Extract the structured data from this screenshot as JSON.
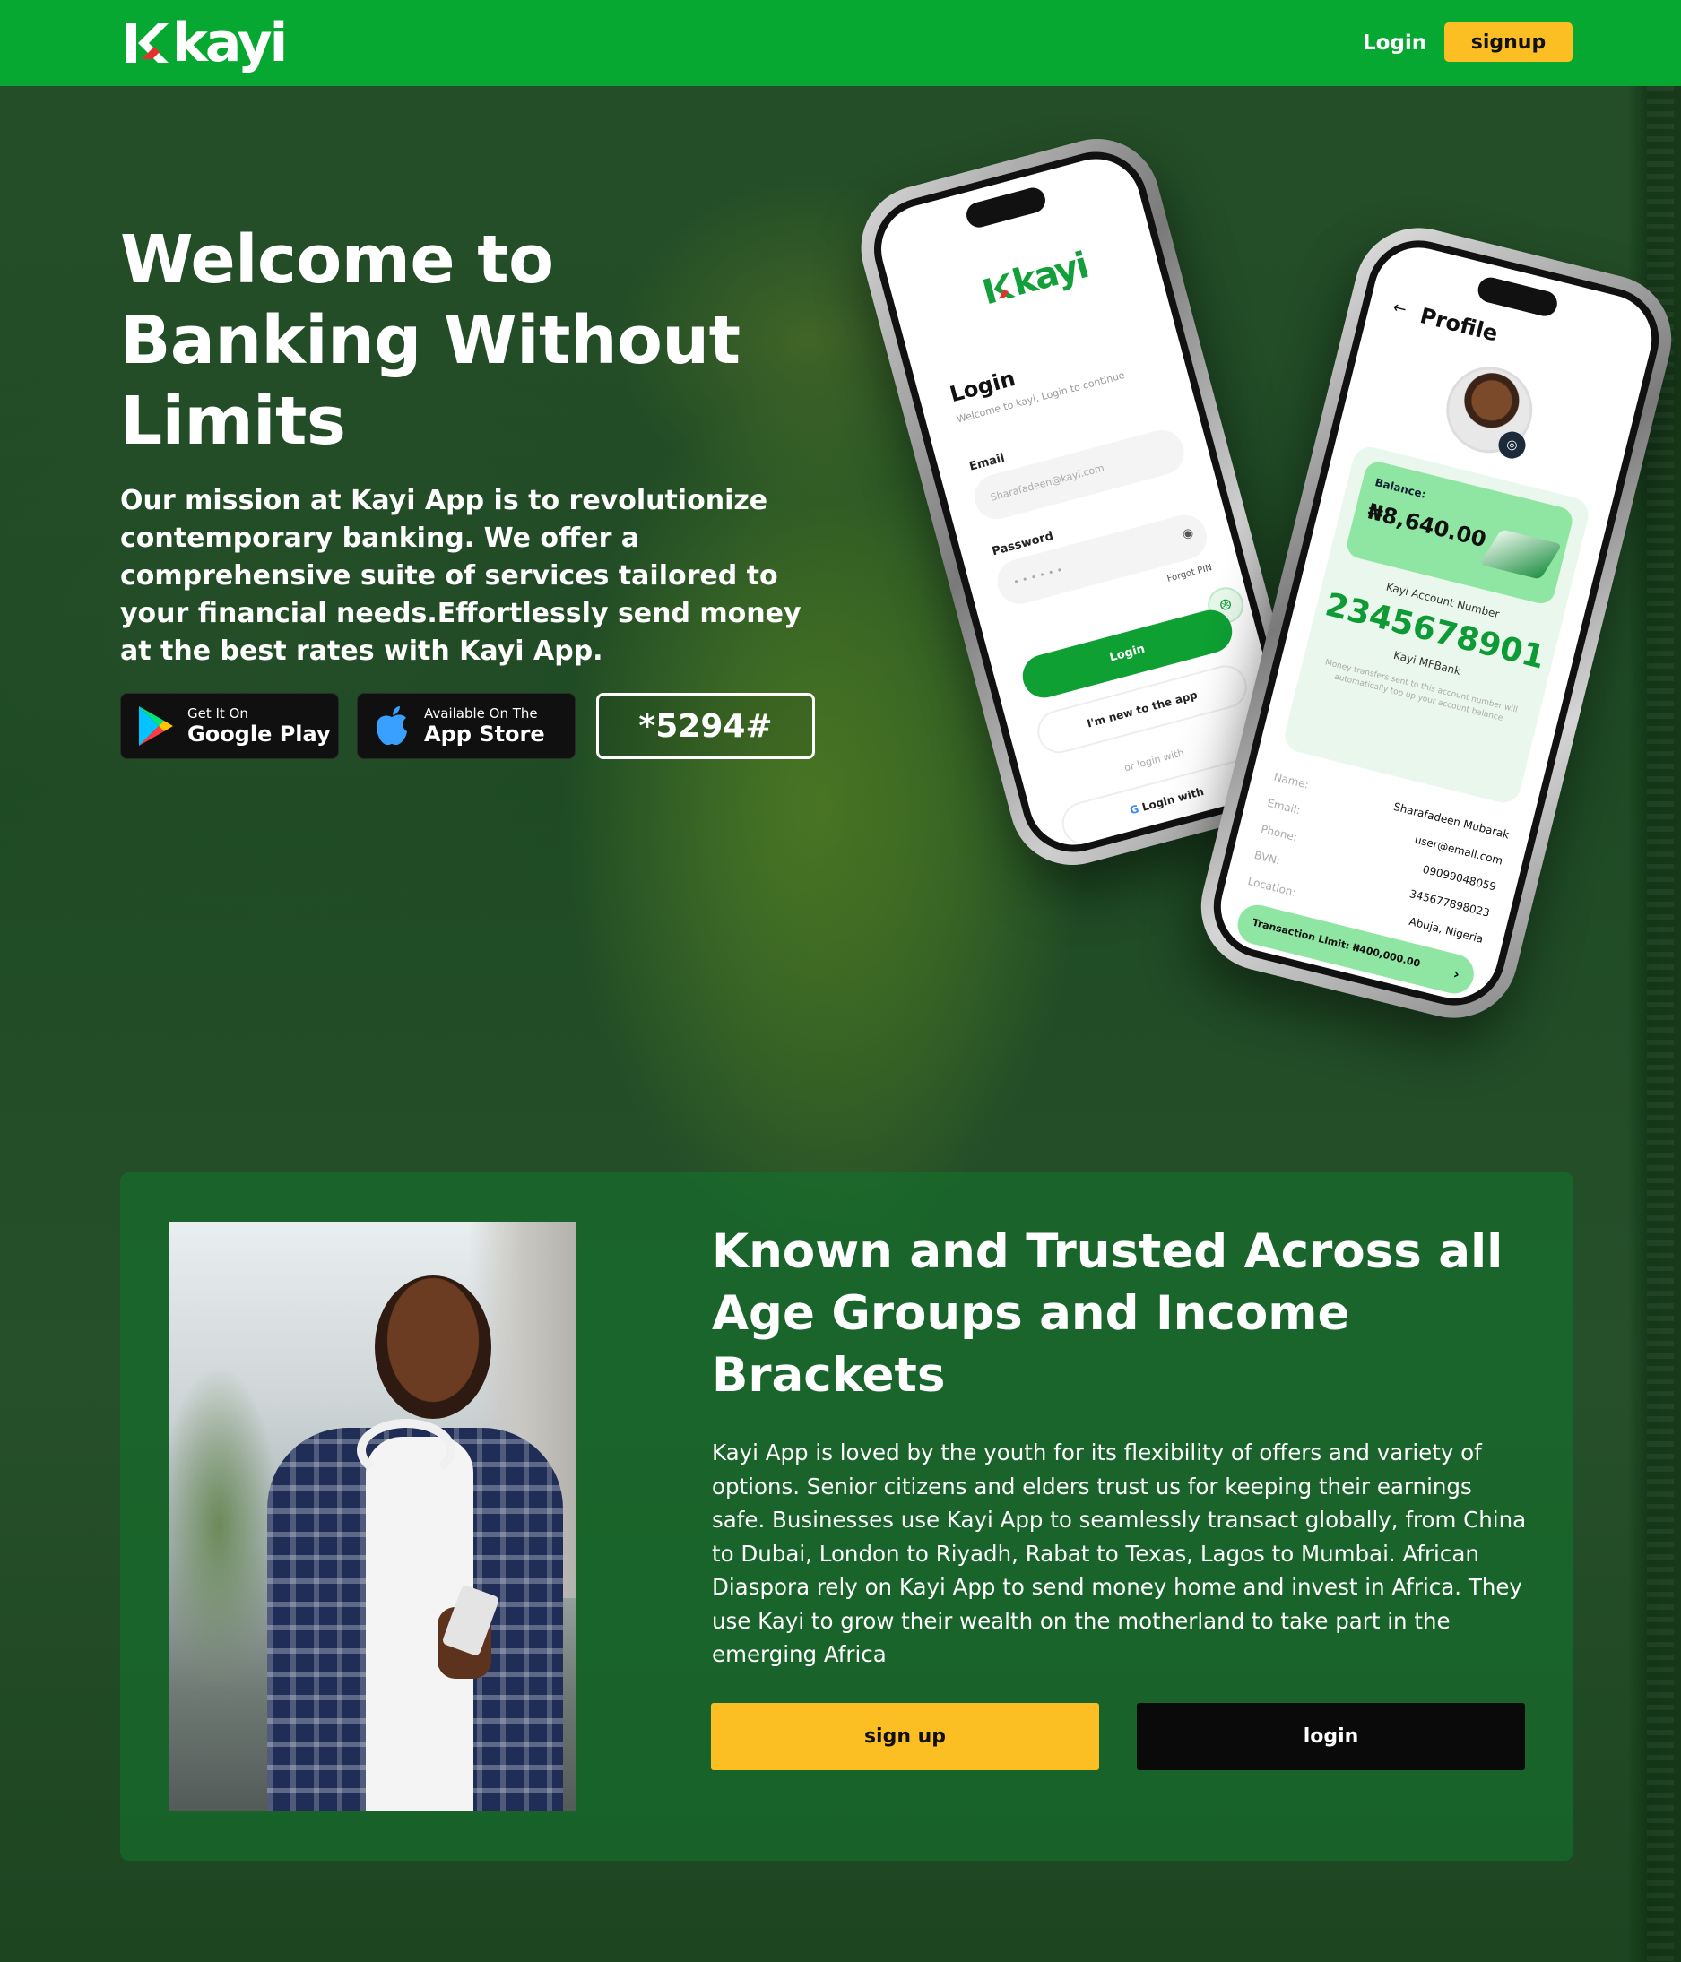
{
  "header": {
    "logo_text": "kayi",
    "login_label": "Login",
    "signup_label": "signup"
  },
  "hero": {
    "title": "Welcome to Banking Without Limits",
    "description": "Our mission at Kayi App is to revolutionize contemporary banking. We offer a comprehensive suite of services tailored to your financial needs.Effortlessly send money at the best rates with Kayi App.",
    "google_play": {
      "small": "Get It On",
      "big": "Google Play",
      "icon": "google-play-icon"
    },
    "app_store": {
      "small": "Available On The",
      "big": "App Store",
      "icon": "apple-icon"
    },
    "ussd_code": "*5294#"
  },
  "phone_login": {
    "logo": "kayi",
    "title": "Login",
    "subtitle": "Welcome to kayi, Login to continue",
    "email_label": "Email",
    "email_value": "Sharafadeen@kayi.com",
    "password_label": "Password",
    "password_value": "• • • • • •",
    "forgot_pin": "Forgot PIN",
    "login_button": "Login",
    "new_button": "I'm new to the app",
    "or_text": "or login with",
    "google_button": "Login with"
  },
  "phone_profile": {
    "title": "Profile",
    "balance_label": "Balance:",
    "balance_value": "₦8,640.00",
    "account_label": "Kayi Account Number",
    "account_number": "2345678901",
    "bank_name": "Kayi MFBank",
    "note": "Money transfers sent to this account number will automatically top up your account balance",
    "fields": [
      {
        "key": "Name:",
        "value": "Sharafadeen Mubarak"
      },
      {
        "key": "Email:",
        "value": "user@email.com"
      },
      {
        "key": "Phone:",
        "value": "09099048059"
      },
      {
        "key": "BVN:",
        "value": "345677898023"
      },
      {
        "key": "Location:",
        "value": "Abuja, Nigeria"
      }
    ],
    "limit_text": "Transaction Limit: ₦400,000.00"
  },
  "trust": {
    "title": "Known and Trusted Across all Age Groups and Income Brackets",
    "text": "Kayi App is loved by the youth for its flexibility of offers and variety of options. Senior citizens and elders trust us for keeping their earnings safe. Businesses use Kayi App to seamlessly transact globally, from China to Dubai, London to Riyadh, Rabat to Texas, Lagos to Mumbai. African Diaspora rely on Kayi App to send money home and invest in Africa. They use Kayi to grow their wealth on the motherland to take part in the emerging Africa",
    "signup_label": "sign up",
    "login_label": "login"
  },
  "colors": {
    "header_green": "#06a832",
    "accent_yellow": "#fbbf24",
    "card_green": "#166e2d",
    "dark": "#0a0a0a"
  }
}
